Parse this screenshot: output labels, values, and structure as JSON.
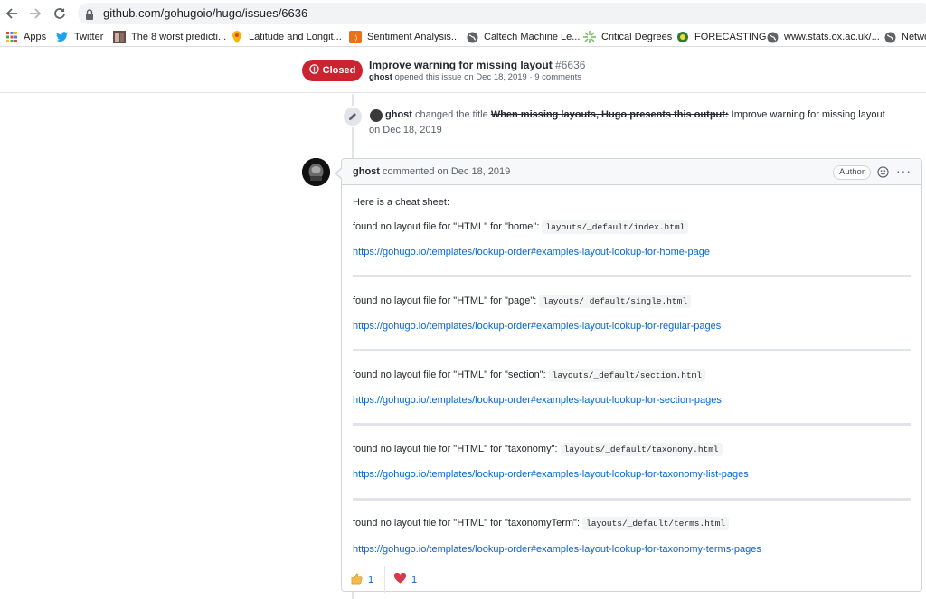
{
  "browser": {
    "url": "github.com/gohugoio/hugo/issues/6636",
    "bookmarks": [
      {
        "label": "Apps",
        "icon": "apps-grid-icon"
      },
      {
        "label": "Twitter",
        "icon": "twitter-icon"
      },
      {
        "label": "The 8 worst predicti...",
        "icon": "article-icon"
      },
      {
        "label": "Latitude and Longit...",
        "icon": "map-pin-icon"
      },
      {
        "label": "Sentiment Analysis...",
        "icon": "sentiment-icon"
      },
      {
        "label": "Caltech Machine Le...",
        "icon": "globe-icon"
      },
      {
        "label": "Critical Degrees",
        "icon": "spark-icon"
      },
      {
        "label": "FORECASTING",
        "icon": "forecasting-icon"
      },
      {
        "label": "www.stats.ox.ac.uk/...",
        "icon": "globe-icon"
      },
      {
        "label": "Netwo",
        "icon": "globe-icon"
      }
    ]
  },
  "issue": {
    "state": "Closed",
    "title": "Improve warning for missing layout",
    "number": "#6636",
    "meta_author": "ghost",
    "meta_rest": "opened this issue on Dec 18, 2019 · 9 comments"
  },
  "event": {
    "user": "ghost",
    "action": "changed the title",
    "old_title": "When missing layouts, Hugo presents this output:",
    "new_title": "Improve warning for missing layout",
    "date": "on Dec 18, 2019"
  },
  "comment": {
    "author": "ghost",
    "commented_on": "commented on Dec 18, 2019",
    "author_badge": "Author",
    "intro": "Here is a cheat sheet:",
    "entries": [
      {
        "text": "found no layout file for \"HTML\" for \"home\": ",
        "code": "layouts/_default/index.html",
        "link": "https://gohugo.io/templates/lookup-order#examples-layout-lookup-for-home-page"
      },
      {
        "text": "found no layout file for \"HTML\" for \"page\": ",
        "code": "layouts/_default/single.html",
        "link": "https://gohugo.io/templates/lookup-order#examples-layout-lookup-for-regular-pages"
      },
      {
        "text": "found no layout file for \"HTML\" for \"section\": ",
        "code": "layouts/_default/section.html",
        "link": "https://gohugo.io/templates/lookup-order#examples-layout-lookup-for-section-pages"
      },
      {
        "text": "found no layout file for \"HTML\" for \"taxonomy\": ",
        "code": "layouts/_default/taxonomy.html",
        "link": "https://gohugo.io/templates/lookup-order#examples-layout-lookup-for-taxonomy-list-pages"
      },
      {
        "text": "found no layout file for \"HTML\" for \"taxonomyTerm\": ",
        "code": "layouts/_default/terms.html",
        "link": "https://gohugo.io/templates/lookup-order#examples-layout-lookup-for-taxonomy-terms-pages"
      }
    ],
    "reactions": [
      {
        "emoji": "thumbs-up-icon",
        "count": "1"
      },
      {
        "emoji": "heart-icon",
        "count": "1"
      }
    ]
  },
  "colors": {
    "closed_red": "#cb2431",
    "link_blue": "#0366d6",
    "heart_red": "#d73a49"
  }
}
